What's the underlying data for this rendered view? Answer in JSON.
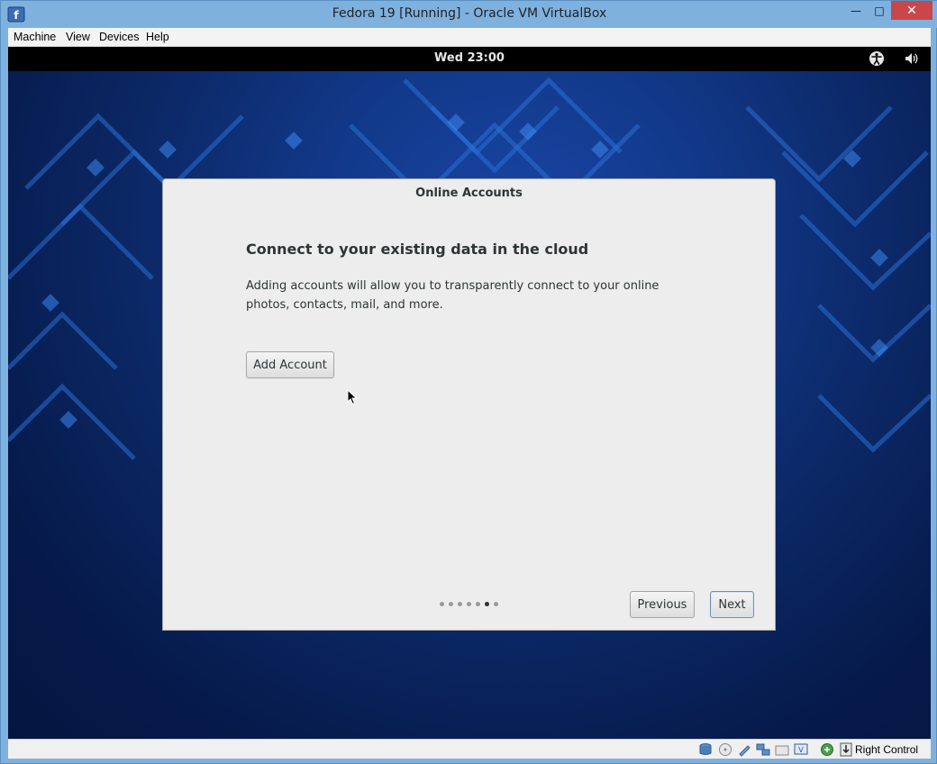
{
  "window": {
    "title": "Fedora 19 [Running] - Oracle VM VirtualBox",
    "minimize_glyph": "—",
    "maximize_glyph": "□",
    "close_glyph": "✕"
  },
  "menubar": {
    "items": [
      "Machine",
      "View",
      "Devices",
      "Help"
    ]
  },
  "guest": {
    "topbar": {
      "clock": "Wed 23:00",
      "icons": [
        "accessibility-icon",
        "volume-icon"
      ]
    },
    "dialog": {
      "title": "Online Accounts",
      "heading": "Connect to your existing data in the cloud",
      "description": "Adding accounts will allow you to transparently connect to your online photos, contacts, mail, and more.",
      "add_account_label": "Add Account",
      "previous_label": "Previous",
      "next_label": "Next",
      "pager": {
        "total": 7,
        "active_index": 5
      }
    }
  },
  "statusbar": {
    "host_key": "Right Control",
    "icons": [
      "hard-disk-icon",
      "optical-drive-icon",
      "usb-icon",
      "network-icon",
      "shared-folders-icon",
      "display-icon",
      "video-capture-icon",
      "mouse-integration-icon"
    ]
  },
  "colors": {
    "close_button": "#c9474a",
    "guest_wallpaper": "#123a8c",
    "dialog_bg": "#ededed"
  }
}
